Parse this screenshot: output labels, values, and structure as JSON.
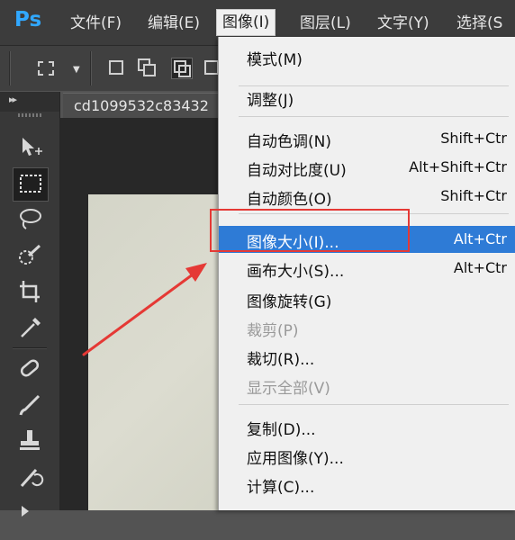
{
  "app": {
    "logo": "Ps",
    "brand_color": "#31a8ff"
  },
  "menubar": {
    "items": [
      {
        "label": "文件(F)"
      },
      {
        "label": "编辑(E)"
      },
      {
        "label": "图像(I)",
        "active": true
      },
      {
        "label": "图层(L)"
      },
      {
        "label": "文字(Y)"
      },
      {
        "label": "选择(S"
      }
    ]
  },
  "document": {
    "tab_title": "cd1099532c83432"
  },
  "tools": [
    "move-tool",
    "rectangular-marquee-tool",
    "lasso-tool",
    "quick-selection-tool",
    "crop-tool",
    "eyedropper-tool",
    "spot-healing-brush-tool",
    "brush-tool",
    "clone-stamp-tool",
    "history-brush-tool"
  ],
  "image_menu": {
    "items": [
      {
        "label": "模式(M)",
        "shortcut": ""
      },
      {
        "label": "调整(J)",
        "shortcut": ""
      },
      {
        "label": "自动色调(N)",
        "shortcut": "Shift+Ctr"
      },
      {
        "label": "自动对比度(U)",
        "shortcut": "Alt+Shift+Ctr"
      },
      {
        "label": "自动颜色(O)",
        "shortcut": "Shift+Ctr"
      },
      {
        "label": "图像大小(I)...",
        "shortcut": "Alt+Ctr",
        "highlighted": true
      },
      {
        "label": "画布大小(S)...",
        "shortcut": "Alt+Ctr"
      },
      {
        "label": "图像旋转(G)",
        "shortcut": ""
      },
      {
        "label": "裁剪(P)",
        "shortcut": "",
        "disabled": true
      },
      {
        "label": "裁切(R)...",
        "shortcut": ""
      },
      {
        "label": "显示全部(V)",
        "shortcut": "",
        "disabled": true
      },
      {
        "label": "复制(D)...",
        "shortcut": ""
      },
      {
        "label": "应用图像(Y)...",
        "shortcut": ""
      },
      {
        "label": "计算(C)...",
        "shortcut": ""
      }
    ]
  },
  "colors": {
    "highlight": "#2e7bd6",
    "annotation": "#e53935"
  }
}
